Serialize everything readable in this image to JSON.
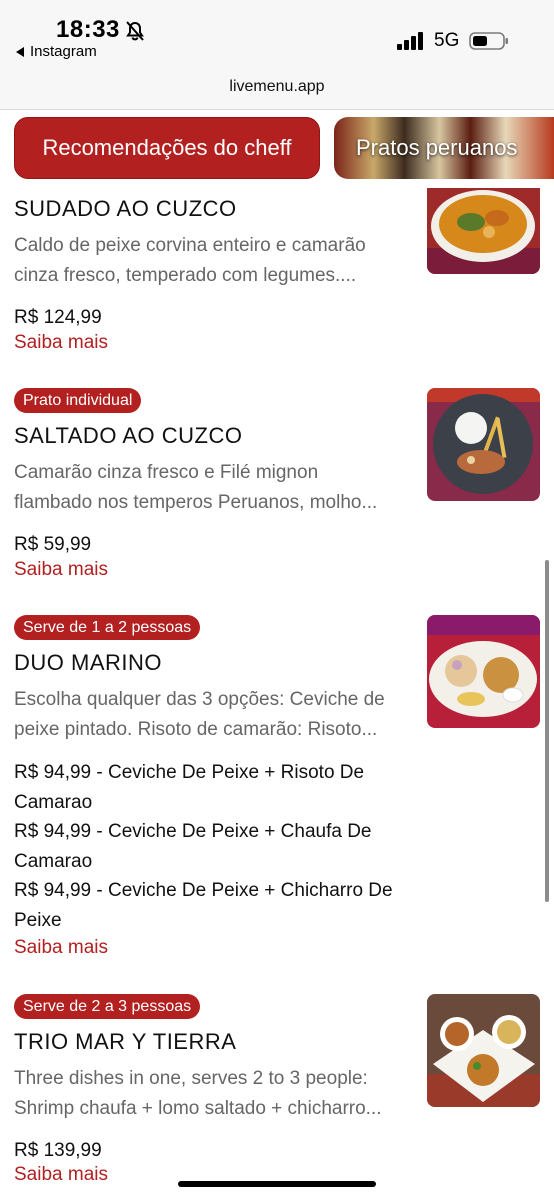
{
  "status_bar": {
    "time": "18:33",
    "back_app": "Instagram",
    "network": "5G"
  },
  "browser": {
    "url": "livemenu.app"
  },
  "tabs": [
    {
      "label": "Recomendações do cheff"
    },
    {
      "label": "Pratos peruanos"
    }
  ],
  "items": [
    {
      "badge": "",
      "name": "SUDADO AO CUZCO",
      "desc_line1": "Caldo de peixe corvina enteiro e camarão",
      "desc_line2": "cinza fresco, temperado com legumes....",
      "prices": [
        "R$ 124,99"
      ],
      "more": "Saiba mais"
    },
    {
      "badge": "Prato individual",
      "name": "SALTADO AO CUZCO",
      "desc_line1": "Camarão cinza fresco e Filé mignon",
      "desc_line2": "flambado nos temperos Peruanos, molho...",
      "prices": [
        "R$ 59,99"
      ],
      "more": "Saiba mais"
    },
    {
      "badge": "Serve de 1 a 2 pessoas",
      "name": "DUO MARINO",
      "desc_line1": "Escolha qualquer das 3 opções: Ceviche de",
      "desc_line2": "peixe pintado. Risoto de camarão: Risoto...",
      "prices": [
        "R$ 94,99 - Ceviche De Peixe + Risoto De Camarao",
        "R$ 94,99 - Ceviche De Peixe + Chaufa De Camarao",
        "R$ 94,99 - Ceviche De Peixe + Chicharro De Peixe"
      ],
      "more": "Saiba mais"
    },
    {
      "badge": "Serve de 2 a 3 pessoas",
      "name": "TRIO MAR Y TIERRA",
      "desc_line1": "Three dishes in one, serves 2 to 3 people:",
      "desc_line2": "Shrimp chaufa + lomo saltado + chicharro...",
      "prices": [
        "R$ 139,99"
      ],
      "more": "Saiba mais"
    }
  ],
  "colors": {
    "accent": "#b32020",
    "text": "#111111",
    "muted": "#666666"
  },
  "icons": [
    "bell-slash-icon",
    "back-arrow-icon",
    "signal-icon",
    "battery-icon"
  ]
}
